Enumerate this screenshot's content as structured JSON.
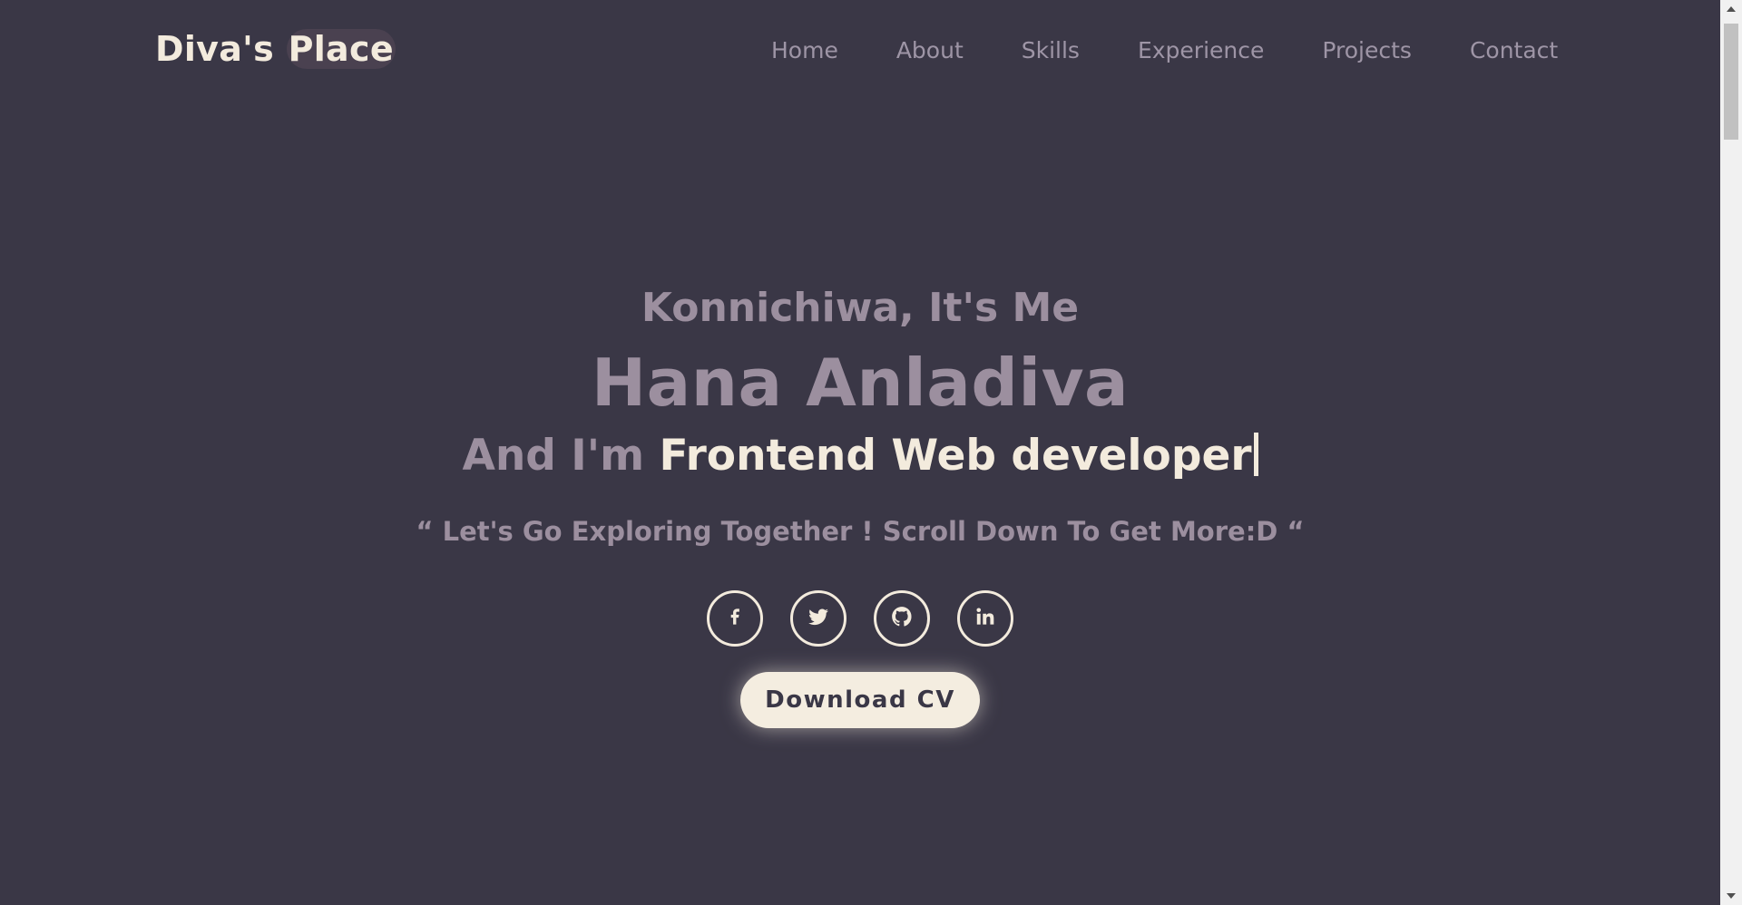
{
  "header": {
    "logo_main": "Diva's ",
    "logo_highlight": "Place",
    "nav": [
      {
        "label": "Home"
      },
      {
        "label": "About"
      },
      {
        "label": "Skills"
      },
      {
        "label": "Experience"
      },
      {
        "label": "Projects"
      },
      {
        "label": "Contact"
      }
    ]
  },
  "hero": {
    "greeting": "Konnichiwa, It's Me",
    "name": "Hana Anladiva",
    "role_prefix": "And I'm ",
    "role_typed": "Frontend Web developer",
    "tagline": "“ Let's Go Exploring Together ! Scroll Down To Get More:D “",
    "socials": [
      {
        "icon": "facebook-icon"
      },
      {
        "icon": "twitter-icon"
      },
      {
        "icon": "github-icon"
      },
      {
        "icon": "linkedin-icon"
      }
    ],
    "cv_button": "Download CV"
  },
  "colors": {
    "background": "#3a3746",
    "accent_light": "#f3ebdd",
    "muted_text": "#9c8f9f",
    "nav_text": "#9e95a6"
  }
}
